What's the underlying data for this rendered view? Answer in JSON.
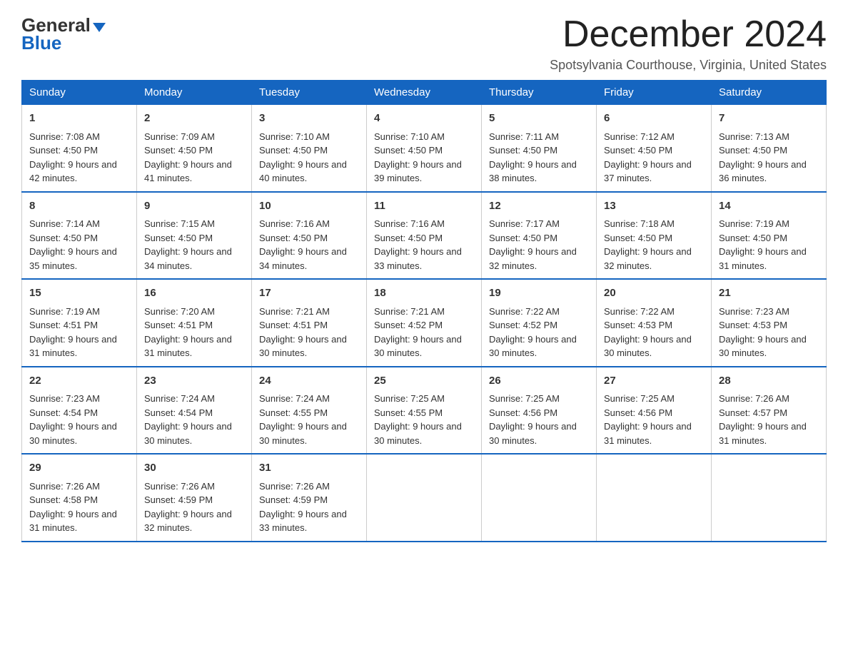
{
  "logo": {
    "line1": "General",
    "arrow": true,
    "line2": "Blue"
  },
  "header": {
    "month_title": "December 2024",
    "subtitle": "Spotsylvania Courthouse, Virginia, United States"
  },
  "days_of_week": [
    "Sunday",
    "Monday",
    "Tuesday",
    "Wednesday",
    "Thursday",
    "Friday",
    "Saturday"
  ],
  "weeks": [
    [
      {
        "day": "1",
        "sunrise": "7:08 AM",
        "sunset": "4:50 PM",
        "daylight": "9 hours and 42 minutes."
      },
      {
        "day": "2",
        "sunrise": "7:09 AM",
        "sunset": "4:50 PM",
        "daylight": "9 hours and 41 minutes."
      },
      {
        "day": "3",
        "sunrise": "7:10 AM",
        "sunset": "4:50 PM",
        "daylight": "9 hours and 40 minutes."
      },
      {
        "day": "4",
        "sunrise": "7:10 AM",
        "sunset": "4:50 PM",
        "daylight": "9 hours and 39 minutes."
      },
      {
        "day": "5",
        "sunrise": "7:11 AM",
        "sunset": "4:50 PM",
        "daylight": "9 hours and 38 minutes."
      },
      {
        "day": "6",
        "sunrise": "7:12 AM",
        "sunset": "4:50 PM",
        "daylight": "9 hours and 37 minutes."
      },
      {
        "day": "7",
        "sunrise": "7:13 AM",
        "sunset": "4:50 PM",
        "daylight": "9 hours and 36 minutes."
      }
    ],
    [
      {
        "day": "8",
        "sunrise": "7:14 AM",
        "sunset": "4:50 PM",
        "daylight": "9 hours and 35 minutes."
      },
      {
        "day": "9",
        "sunrise": "7:15 AM",
        "sunset": "4:50 PM",
        "daylight": "9 hours and 34 minutes."
      },
      {
        "day": "10",
        "sunrise": "7:16 AM",
        "sunset": "4:50 PM",
        "daylight": "9 hours and 34 minutes."
      },
      {
        "day": "11",
        "sunrise": "7:16 AM",
        "sunset": "4:50 PM",
        "daylight": "9 hours and 33 minutes."
      },
      {
        "day": "12",
        "sunrise": "7:17 AM",
        "sunset": "4:50 PM",
        "daylight": "9 hours and 32 minutes."
      },
      {
        "day": "13",
        "sunrise": "7:18 AM",
        "sunset": "4:50 PM",
        "daylight": "9 hours and 32 minutes."
      },
      {
        "day": "14",
        "sunrise": "7:19 AM",
        "sunset": "4:50 PM",
        "daylight": "9 hours and 31 minutes."
      }
    ],
    [
      {
        "day": "15",
        "sunrise": "7:19 AM",
        "sunset": "4:51 PM",
        "daylight": "9 hours and 31 minutes."
      },
      {
        "day": "16",
        "sunrise": "7:20 AM",
        "sunset": "4:51 PM",
        "daylight": "9 hours and 31 minutes."
      },
      {
        "day": "17",
        "sunrise": "7:21 AM",
        "sunset": "4:51 PM",
        "daylight": "9 hours and 30 minutes."
      },
      {
        "day": "18",
        "sunrise": "7:21 AM",
        "sunset": "4:52 PM",
        "daylight": "9 hours and 30 minutes."
      },
      {
        "day": "19",
        "sunrise": "7:22 AM",
        "sunset": "4:52 PM",
        "daylight": "9 hours and 30 minutes."
      },
      {
        "day": "20",
        "sunrise": "7:22 AM",
        "sunset": "4:53 PM",
        "daylight": "9 hours and 30 minutes."
      },
      {
        "day": "21",
        "sunrise": "7:23 AM",
        "sunset": "4:53 PM",
        "daylight": "9 hours and 30 minutes."
      }
    ],
    [
      {
        "day": "22",
        "sunrise": "7:23 AM",
        "sunset": "4:54 PM",
        "daylight": "9 hours and 30 minutes."
      },
      {
        "day": "23",
        "sunrise": "7:24 AM",
        "sunset": "4:54 PM",
        "daylight": "9 hours and 30 minutes."
      },
      {
        "day": "24",
        "sunrise": "7:24 AM",
        "sunset": "4:55 PM",
        "daylight": "9 hours and 30 minutes."
      },
      {
        "day": "25",
        "sunrise": "7:25 AM",
        "sunset": "4:55 PM",
        "daylight": "9 hours and 30 minutes."
      },
      {
        "day": "26",
        "sunrise": "7:25 AM",
        "sunset": "4:56 PM",
        "daylight": "9 hours and 30 minutes."
      },
      {
        "day": "27",
        "sunrise": "7:25 AM",
        "sunset": "4:56 PM",
        "daylight": "9 hours and 31 minutes."
      },
      {
        "day": "28",
        "sunrise": "7:26 AM",
        "sunset": "4:57 PM",
        "daylight": "9 hours and 31 minutes."
      }
    ],
    [
      {
        "day": "29",
        "sunrise": "7:26 AM",
        "sunset": "4:58 PM",
        "daylight": "9 hours and 31 minutes."
      },
      {
        "day": "30",
        "sunrise": "7:26 AM",
        "sunset": "4:59 PM",
        "daylight": "9 hours and 32 minutes."
      },
      {
        "day": "31",
        "sunrise": "7:26 AM",
        "sunset": "4:59 PM",
        "daylight": "9 hours and 33 minutes."
      },
      null,
      null,
      null,
      null
    ]
  ],
  "labels": {
    "sunrise": "Sunrise: ",
    "sunset": "Sunset: ",
    "daylight": "Daylight: "
  }
}
